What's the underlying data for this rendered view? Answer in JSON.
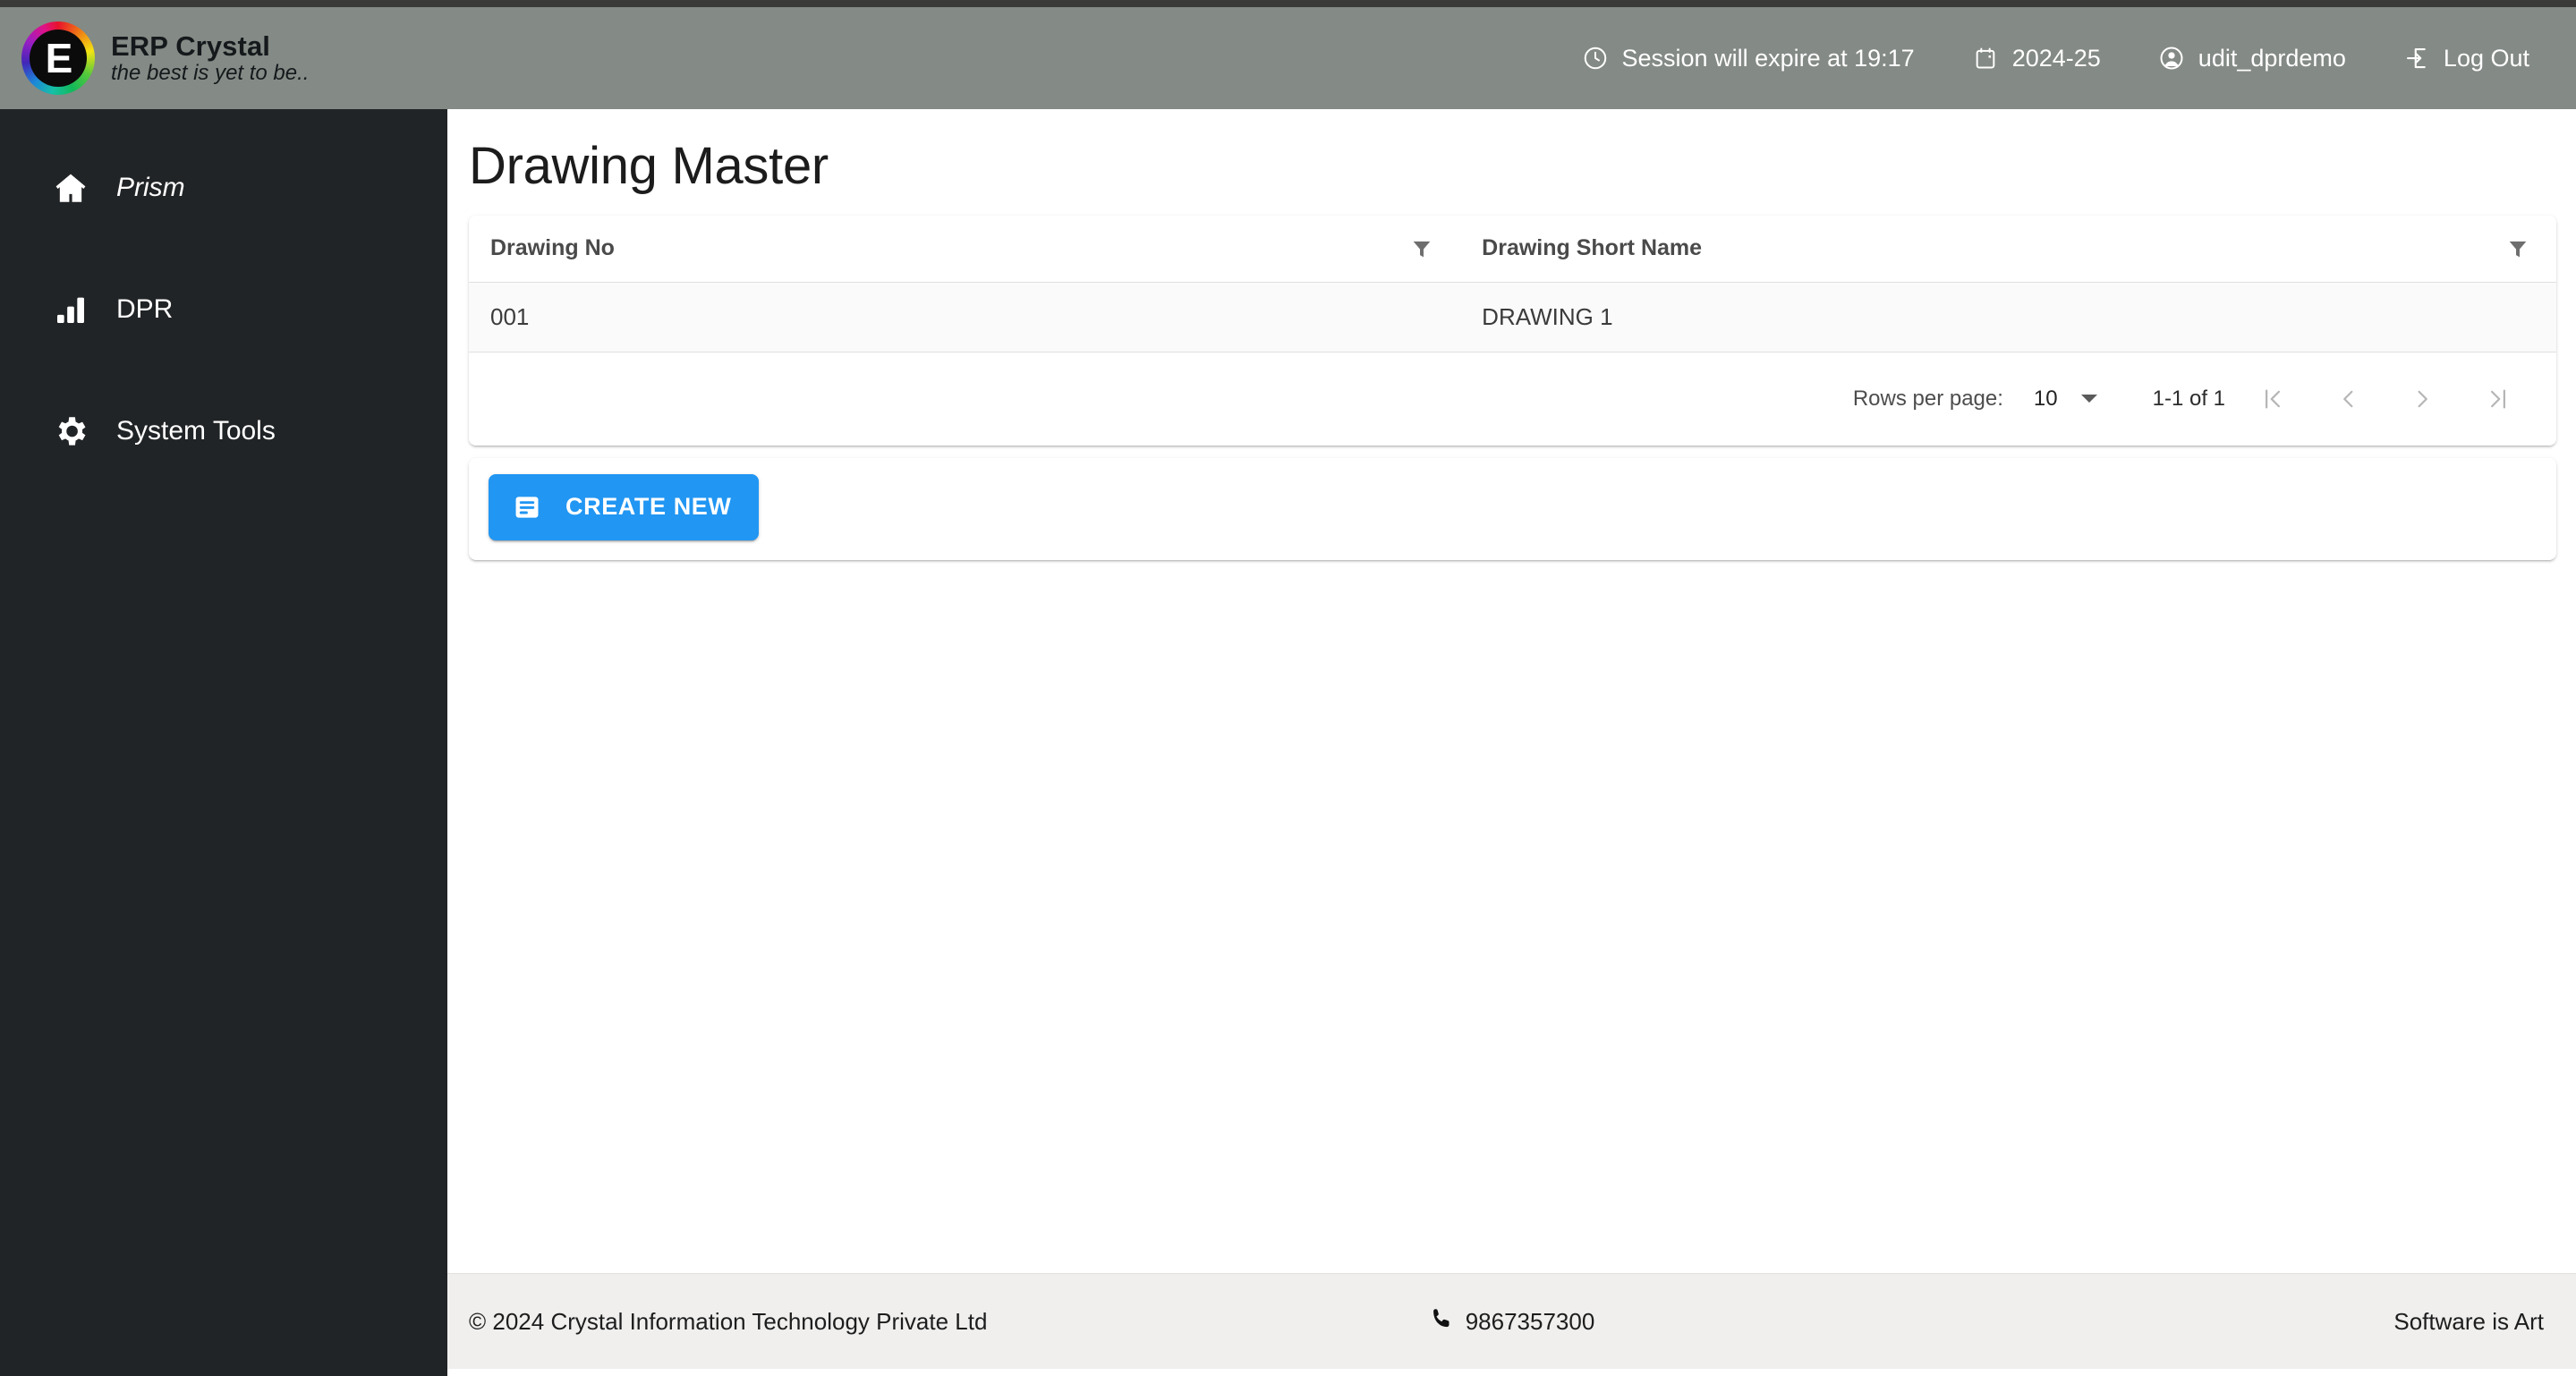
{
  "brand": {
    "title": "ERP Crystal",
    "tagline": "the best is yet to be..",
    "logo_glyph": "E",
    "logo_icon": "erp-crystal-logo"
  },
  "header": {
    "session": {
      "icon": "clock-icon",
      "label": "Session will expire at 19:17"
    },
    "fiscal_year": {
      "icon": "calendar-icon",
      "label": "2024-25"
    },
    "user": {
      "icon": "account-circle-icon",
      "label": "udit_dprdemo"
    },
    "logout": {
      "icon": "logout-icon",
      "label": "Log Out"
    },
    "background_color": "#848a85"
  },
  "sidebar": {
    "background_color": "#212426",
    "items": [
      {
        "icon": "home-icon",
        "label": "Prism",
        "italic": true
      },
      {
        "icon": "chart-icon",
        "label": "DPR",
        "italic": false
      },
      {
        "icon": "gear-icon",
        "label": "System Tools",
        "italic": false
      }
    ]
  },
  "main": {
    "page_title": "Drawing Master",
    "table": {
      "columns": [
        {
          "label": "Drawing No",
          "filter_icon": "filter-icon"
        },
        {
          "label": "Drawing Short Name",
          "filter_icon": "filter-icon"
        }
      ],
      "rows": [
        {
          "drawing_no": "001",
          "drawing_short_name": "DRAWING 1"
        }
      ],
      "link_color": "#5a48e8"
    },
    "paginator": {
      "rows_per_page_label": "Rows per page:",
      "rows_per_page_value": "10",
      "range_label": "1-1 of 1",
      "first_page_icon": "first-page-icon",
      "prev_page_icon": "chevron-left-icon",
      "next_page_icon": "chevron-right-icon",
      "last_page_icon": "last-page-icon"
    },
    "create_button": {
      "label": "CREATE NEW",
      "icon": "article-icon",
      "color": "#2196f3"
    }
  },
  "footer": {
    "copyright": "© 2024 Crystal Information Technology Private Ltd",
    "phone_icon": "phone-icon",
    "phone": "9867357300",
    "slogan": "Software is Art"
  }
}
